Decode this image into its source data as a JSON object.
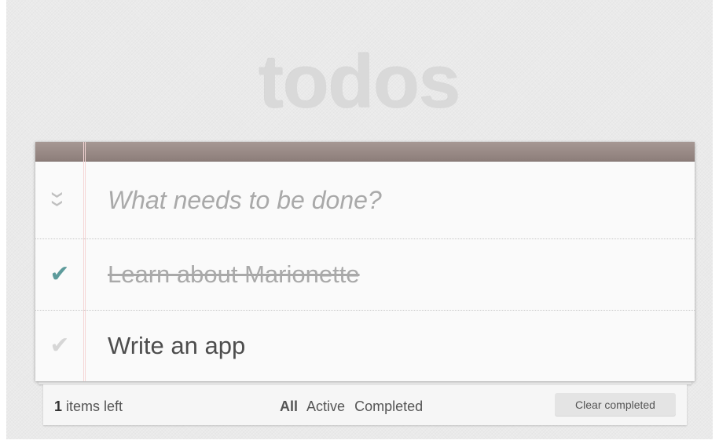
{
  "app": {
    "title": "todos"
  },
  "new_todo": {
    "placeholder": "What needs to be done?",
    "toggle_all_icon": "double-chevron-down-icon"
  },
  "todos": [
    {
      "label": "Learn about Marionette",
      "completed": true,
      "icon": "checkmark-icon"
    },
    {
      "label": "Write an app",
      "completed": false,
      "icon": "checkmark-icon"
    }
  ],
  "footer": {
    "count": "1",
    "count_suffix": " items left",
    "filters": [
      {
        "label": "All",
        "selected": true
      },
      {
        "label": "Active",
        "selected": false
      },
      {
        "label": "Completed",
        "selected": false
      }
    ],
    "clear_label": "Clear completed"
  },
  "colors": {
    "header_bar": "#8d7e7a",
    "check_done": "#5d9b9b",
    "check_undone": "#d6d6d6",
    "title": "#d9d9d9",
    "margin_line": "#f5d6d6"
  }
}
